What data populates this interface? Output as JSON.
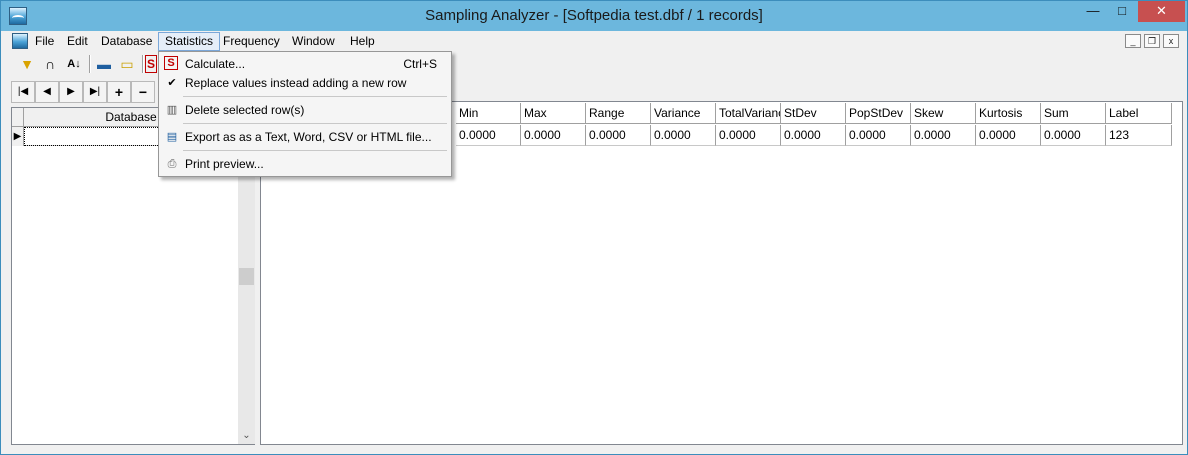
{
  "window": {
    "title": "Sampling Analyzer - [Softpedia test.dbf / 1 records]",
    "controls": {
      "minimize": "—",
      "maximize": "□",
      "close": "✕"
    }
  },
  "menubar": {
    "items": [
      "File",
      "Edit",
      "Database",
      "Statistics",
      "Frequency",
      "Window",
      "Help"
    ],
    "active": "Statistics",
    "mdi_controls": {
      "minimize": "_",
      "restore": "❐",
      "close": "x"
    }
  },
  "toolbar": {
    "icons": [
      "filter-icon",
      "curve-icon",
      "sort-icon",
      "save-icon",
      "open-folder-icon",
      "statistics-icon"
    ],
    "glyphs": {
      "filter": "▼",
      "curve": "∩",
      "sort": "A↓",
      "save": "▬",
      "open": "▭",
      "stats": "S"
    }
  },
  "navigator": {
    "buttons": [
      {
        "name": "first-record",
        "glyph": "|◀"
      },
      {
        "name": "prior-record",
        "glyph": "◀"
      },
      {
        "name": "next-record",
        "glyph": "▶"
      },
      {
        "name": "last-record",
        "glyph": "▶|"
      },
      {
        "name": "insert-record",
        "glyph": "+"
      },
      {
        "name": "delete-record",
        "glyph": "−"
      }
    ]
  },
  "left_grid": {
    "column": "Database",
    "indicator": "▶",
    "rows": [
      ""
    ]
  },
  "results_grid": {
    "columns": [
      "Min",
      "Max",
      "Range",
      "Variance",
      "TotalVarianc",
      "StDev",
      "PopStDev",
      "Skew",
      "Kurtosis",
      "Sum",
      "Label"
    ],
    "rows": [
      [
        "0.0000",
        "0.0000",
        "0.0000",
        "0.0000",
        "0.0000",
        "0.0000",
        "0.0000",
        "0.0000",
        "0.0000",
        "0.0000",
        "123"
      ]
    ]
  },
  "statistics_menu": {
    "items": [
      {
        "label": "Calculate...",
        "shortcut": "Ctrl+S",
        "icon": "calculate-icon",
        "glyph": "S"
      },
      {
        "label": "Replace values instead adding a new row",
        "shortcut": "",
        "icon": "checkmark-icon",
        "glyph": "✔",
        "checked": true
      },
      {
        "label": "Delete selected row(s)",
        "shortcut": "",
        "icon": "trash-icon",
        "glyph": "▥"
      },
      {
        "label": "Export as as a Text, Word, CSV or HTML file...",
        "shortcut": "",
        "icon": "export-icon",
        "glyph": "▤"
      },
      {
        "label": "Print preview...",
        "shortcut": "",
        "icon": "printer-icon",
        "glyph": "⎙"
      }
    ]
  },
  "colors": {
    "titlebar": "#6cb7dd",
    "close_button": "#c75050",
    "menu_highlight": "#e5eef8"
  }
}
